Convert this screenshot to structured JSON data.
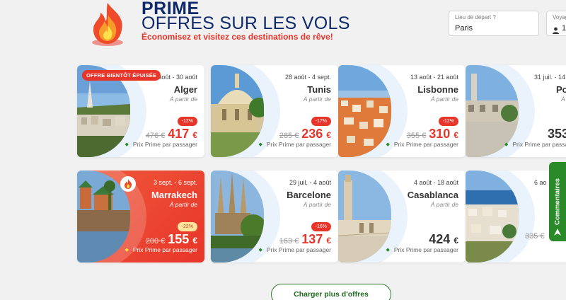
{
  "hero": {
    "title_line1": "PRIME",
    "title_line2": "OFFRES SUR LES VOLS",
    "subtitle": "Économisez et visitez ces destinations de rêve!",
    "icon": "flame-icon"
  },
  "search": {
    "departure_label": "Lieu de départ ?",
    "departure_value": "Paris",
    "travellers_label": "Voyag",
    "travellers_value": "1"
  },
  "common": {
    "from_label": "À partir de",
    "footer_label": "Prix Prime par passager",
    "currency": "€"
  },
  "badges": {
    "soon_out": "OFFRE BIENTÔT ÉPUISÉE"
  },
  "cards": [
    {
      "dates": "…août - 30 août",
      "city": "Alger",
      "discount": "-12%",
      "old_price": "476 €",
      "price": "417",
      "photo_theme": "algiers"
    },
    {
      "dates": "28 août - 4 sept.",
      "city": "Tunis",
      "discount": "-17%",
      "old_price": "285 €",
      "price": "236",
      "photo_theme": "tunis"
    },
    {
      "dates": "13 août - 21 août",
      "city": "Lisbonne",
      "discount": "-12%",
      "old_price": "355 €",
      "price": "310",
      "photo_theme": "lisbon"
    },
    {
      "dates": "31 juil. - 14",
      "city": "Po",
      "discount": "",
      "old_price": "",
      "price": "353",
      "photo_theme": "porto"
    },
    {
      "dates": "3 sept. - 6 sept.",
      "city": "Marrakech",
      "discount": "-22%",
      "old_price": "200 €",
      "price": "155",
      "photo_theme": "marrakech"
    },
    {
      "dates": "29 juil. - 4 août",
      "city": "Barcelone",
      "discount": "-16%",
      "old_price": "163 €",
      "price": "137",
      "photo_theme": "barcelona"
    },
    {
      "dates": "4 août - 18 août",
      "city": "Casablanca",
      "discount": "",
      "old_price": "",
      "price": "424",
      "photo_theme": "casablanca"
    },
    {
      "dates": "6 ao",
      "city": "",
      "discount": "",
      "old_price": "335 €",
      "price": "",
      "photo_theme": "coastal-town"
    }
  ],
  "load_more": "Charger plus d'offres",
  "feedback": "Commentaires",
  "colors": {
    "navy": "#0f2a6b",
    "accent_red": "#e8352a",
    "green": "#2a8a2a"
  }
}
